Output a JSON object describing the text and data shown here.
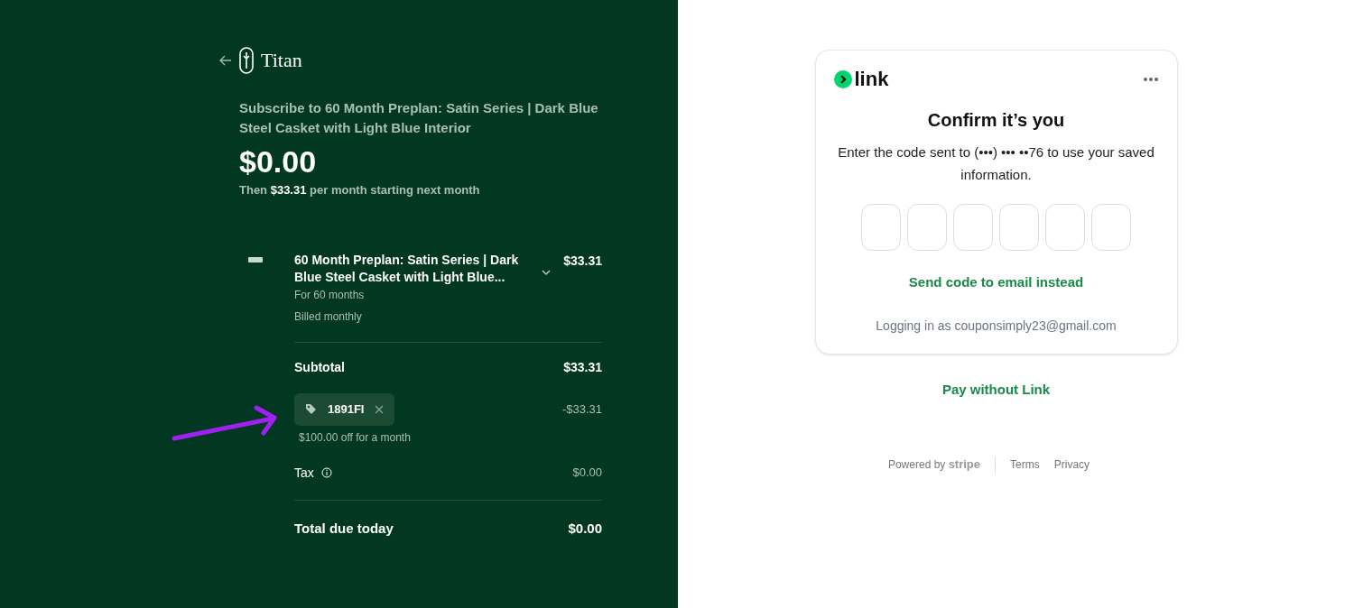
{
  "brand": {
    "name": "Titan"
  },
  "summary": {
    "title": "Subscribe to 60 Month Preplan: Satin Series | Dark Blue Steel Casket with Light Blue Interior",
    "price": "$0.00",
    "then": "Then **$33.31** per month starting next month"
  },
  "line_item": {
    "name": "60 Month Preplan: Satin Series | Dark Blue Steel Casket with Light Blue...",
    "duration": "For 60 months",
    "billing": "Billed monthly",
    "amount": "$33.31",
    "expanded": false
  },
  "subtotal": {
    "label": "Subtotal",
    "amount": "$33.31"
  },
  "coupon": {
    "code": "1891FI",
    "amount": "-$33.31",
    "note": "$100.00 off for a month"
  },
  "tax": {
    "label": "Tax",
    "amount": "$0.00"
  },
  "total": {
    "label": "Total due today",
    "amount": "$0.00"
  },
  "annotation": {
    "kind": "arrow",
    "color": "#a020f0"
  },
  "link_card": {
    "logo": "link",
    "heading": "Confirm it’s you",
    "message": "Enter the code sent to (•••) ••• ••76 to use your saved information.",
    "code_boxes": [
      {
        "kind": "digit"
      },
      {
        "kind": "digit"
      },
      {
        "kind": "digit"
      },
      {
        "kind": "digit"
      },
      {
        "kind": "digit"
      },
      {
        "kind": "digit"
      }
    ],
    "email_link": "Send code to email instead",
    "logged_in": "Logging in as couponsimply23@gmail.com"
  },
  "pay_without": "Pay without Link",
  "footer": {
    "powered": "Powered by **stripe**",
    "links": [
      "Terms",
      "Privacy"
    ]
  }
}
